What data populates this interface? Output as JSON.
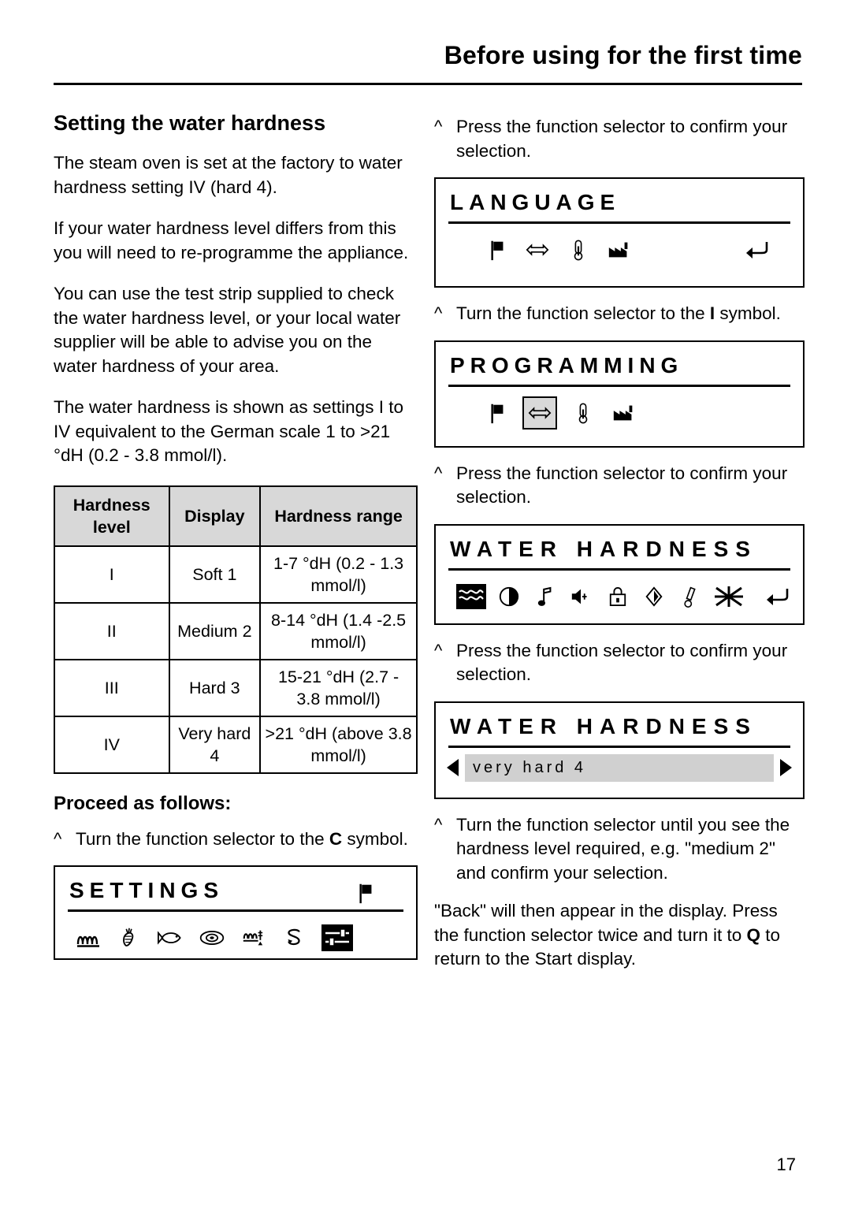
{
  "header": {
    "title": "Before using for the first time"
  },
  "left": {
    "section_title": "Setting the water hardness",
    "paragraphs": [
      "The steam oven is set at the factory to water hardness setting IV (hard 4).",
      "If your water hardness level differs from this you will need to re-programme the appliance.",
      "You can use the test strip supplied to check the water hardness level, or your local water supplier will be able to advise you on the water hardness of your area.",
      "The water hardness is shown as settings I to IV equivalent to the German scale 1 to >21 °dH (0.2 - 3.8 mmol/l)."
    ],
    "table": {
      "headers": [
        "Hardness level",
        "Display",
        "Hardness range"
      ],
      "rows": [
        [
          "I",
          "Soft 1",
          "1-7 °dH (0.2 - 1.3 mmol/l)"
        ],
        [
          "II",
          "Medium 2",
          "8-14 °dH (1.4 -2.5 mmol/l)"
        ],
        [
          "III",
          "Hard 3",
          "15-21 °dH (2.7 - 3.8 mmol/l)"
        ],
        [
          "IV",
          "Very hard 4",
          ">21 °dH (above 3.8 mmol/l)"
        ]
      ]
    },
    "proceed_heading": "Proceed as follows:",
    "step_1": {
      "caret": "^",
      "text_before": "Turn the function selector to the ",
      "symbol": "C",
      "text_after": " symbol."
    },
    "settings_display": {
      "title": "SETTINGS",
      "icons": [
        "heating-element-icon",
        "vegetables-icon",
        "fish-icon",
        "roast-icon",
        "grill-icon",
        "descale-icon",
        "settings-sliders-icon"
      ]
    }
  },
  "right": {
    "step_confirm_1": {
      "caret": "^",
      "text": "Press the function selector to confirm your selection."
    },
    "language_display": {
      "title": "LANGUAGE",
      "icons": [
        "flag-icon",
        "arrows-icon",
        "thermometer-icon",
        "factory-icon",
        "back-arrow-icon"
      ]
    },
    "step_turn_I": {
      "caret": "^",
      "text_before": "Turn the function selector to the ",
      "symbol": "I",
      "text_after": " symbol."
    },
    "programming_display": {
      "title": "PROGRAMMING",
      "icons": [
        "flag-icon",
        "arrows-icon",
        "thermometer-icon",
        "factory-icon"
      ]
    },
    "step_confirm_2": {
      "caret": "^",
      "text": "Press the function selector to confirm your selection."
    },
    "water_hardness_display_1": {
      "title": "WATER HARDNESS",
      "icons": [
        "water-waves-icon",
        "contrast-icon",
        "note-icon",
        "volume-icon",
        "lock-icon",
        "brightness-icon",
        "temperature-icon",
        "water-hardness-icon",
        "back-arrow-icon"
      ]
    },
    "step_confirm_3": {
      "caret": "^",
      "text": "Press the function selector to confirm your selection."
    },
    "water_hardness_display_2": {
      "title": "WATER HARDNESS",
      "value": "very hard 4"
    },
    "step_turn_until": {
      "caret": "^",
      "text": "Turn the function selector until you see the hardness level required, e.g. \"medium 2\" and confirm your selection."
    },
    "final_paragraph": {
      "part1": "\"Back\" will then appear in the display. Press the function selector twice and turn it to ",
      "symbol": "Q",
      "part2": " to return to the Start display."
    }
  },
  "page_number": "17"
}
